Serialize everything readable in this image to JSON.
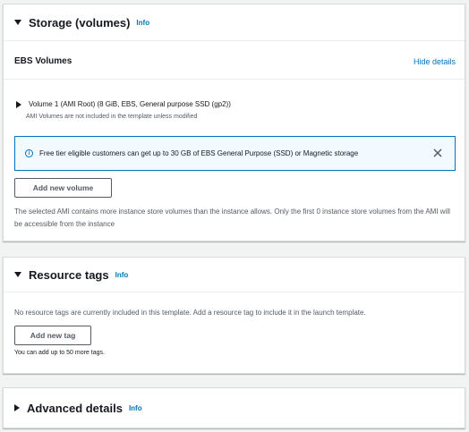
{
  "storage": {
    "title": "Storage (volumes)",
    "info": "Info",
    "ebs_title": "EBS Volumes",
    "hide_details": "Hide details",
    "volume_label": "Volume 1 (AMI Root) (8 GiB, EBS, General purpose SSD (gp2))",
    "volume_note": "AMI Volumes are not included in the template unless modified",
    "flash_text": "Free tier eligible customers can get up to 30 GB of EBS General Purpose (SSD) or Magnetic storage",
    "add_volume": "Add new volume",
    "instance_store_note": "The selected AMI contains more instance store volumes than the instance allows. Only the first 0 instance store volumes from the AMI will be accessible from the instance"
  },
  "tags": {
    "title": "Resource tags",
    "info": "Info",
    "empty_note": "No resource tags are currently included in this template. Add a resource tag to include it in the launch template.",
    "add_tag": "Add new tag",
    "limit_note": "You can add up to 50 more tags."
  },
  "advanced": {
    "title": "Advanced details",
    "info": "Info"
  },
  "colors": {
    "link": "#0073bb",
    "flash_bg": "#f1faff",
    "flash_border": "#0073bb",
    "page_bg": "#f2f3f3"
  },
  "icons": {
    "flash": "info-circle-icon",
    "close": "close-icon",
    "expand": "caret-down-icon",
    "collapsed": "caret-right-icon"
  }
}
